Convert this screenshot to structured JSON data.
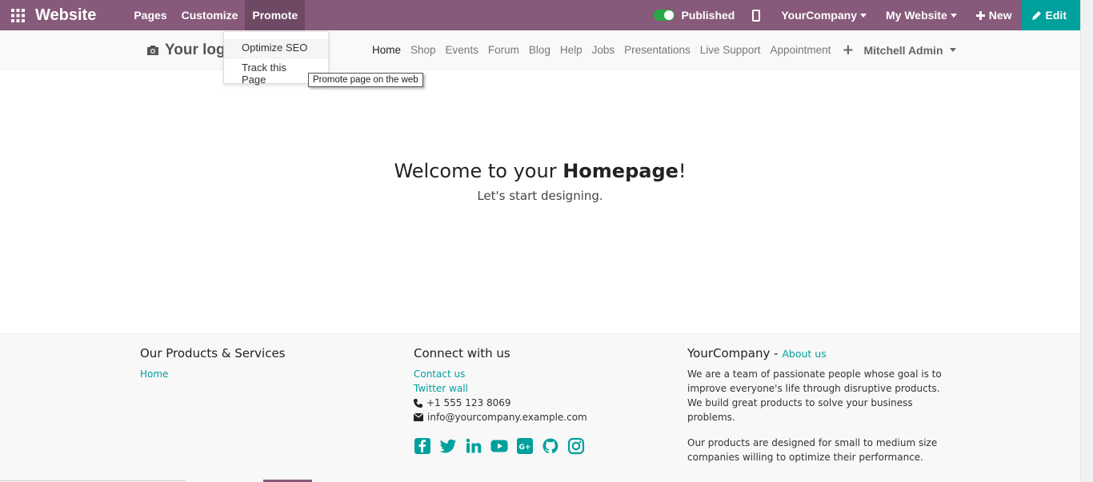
{
  "topbar": {
    "brand": "Website",
    "menu": [
      {
        "label": "Pages"
      },
      {
        "label": "Customize"
      },
      {
        "label": "Promote"
      }
    ],
    "published_label": "Published",
    "company_label": "YourCompany",
    "website_label": "My Website",
    "new_label": "New",
    "edit_label": "Edit"
  },
  "colors": {
    "admin_bar": "#875A7B",
    "accent": "#00A09D",
    "toggle_on": "#28a745"
  },
  "header": {
    "logo_text": "Your log",
    "nav": [
      "Home",
      "Shop",
      "Events",
      "Forum",
      "Blog",
      "Help",
      "Jobs",
      "Presentations",
      "Live Support",
      "Appointment"
    ],
    "user": "Mitchell Admin"
  },
  "dropdown": {
    "items": [
      "Optimize SEO",
      "Track this Page"
    ],
    "tooltip": "Promote page on the web"
  },
  "hero": {
    "title_prefix": "Welcome to your ",
    "title_bold": "Homepage",
    "title_suffix": "!",
    "subtitle": "Let's start designing."
  },
  "footer": {
    "col1": {
      "title": "Our Products & Services",
      "links": [
        "Home"
      ]
    },
    "col2": {
      "title": "Connect with us",
      "links": [
        "Contact us",
        "Twitter wall"
      ],
      "phone": "+1 555 123 8069",
      "email": "info@yourcompany.example.com",
      "social": [
        "facebook-icon",
        "twitter-icon",
        "linkedin-icon",
        "youtube-icon",
        "google-plus-icon",
        "github-icon",
        "instagram-icon"
      ]
    },
    "col3": {
      "title": "YourCompany",
      "separator": " - ",
      "about_link": "About us",
      "para1": "We are a team of passionate people whose goal is to improve everyone's life through disruptive products. We build great products to solve your business problems.",
      "para2": "Our products are designed for small to medium size companies willing to optimize their performance."
    }
  }
}
